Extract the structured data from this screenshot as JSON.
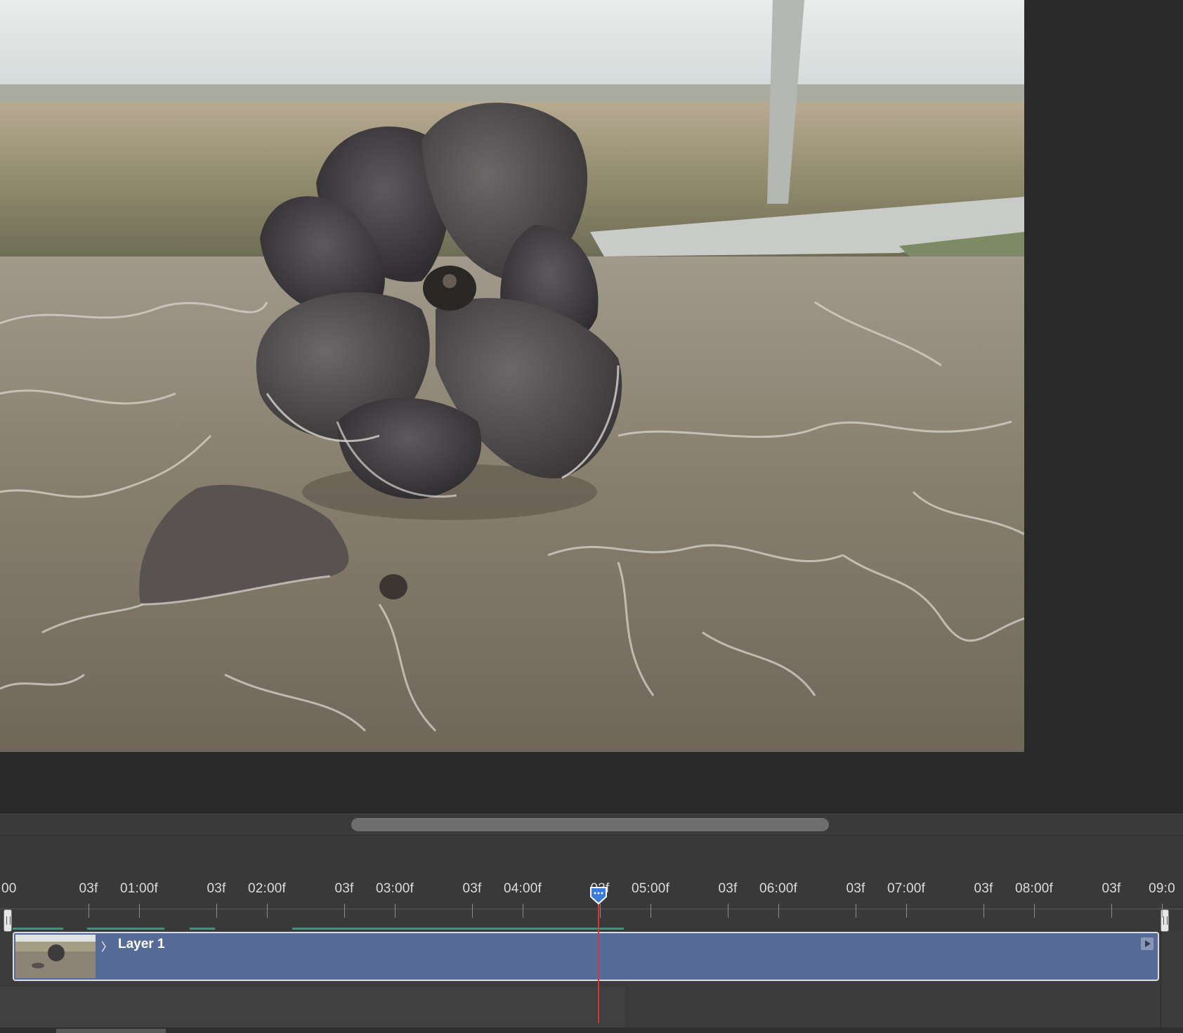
{
  "timeline": {
    "ruler_labels": [
      {
        "label": "00"
      },
      {
        "label": "03f"
      },
      {
        "label": "01:00f"
      },
      {
        "label": "03f"
      },
      {
        "label": "02:00f"
      },
      {
        "label": "03f"
      },
      {
        "label": "03:00f"
      },
      {
        "label": "03f"
      },
      {
        "label": "04:00f"
      },
      {
        "label": "03f"
      },
      {
        "label": "05:00f"
      },
      {
        "label": "03f"
      },
      {
        "label": "06:00f"
      },
      {
        "label": "03f"
      },
      {
        "label": "07:00f"
      },
      {
        "label": "03f"
      },
      {
        "label": "08:00f"
      },
      {
        "label": "03f"
      },
      {
        "label": "09:0"
      }
    ],
    "layer": {
      "name": "Layer 1",
      "disclosure": "〉"
    },
    "colors": {
      "clip": "#566b98",
      "playhead": "#d23a2e",
      "playhead_marker": "#3d7ad6",
      "cached": "#4a8f7e"
    },
    "icons": {
      "playhead": "playhead-marker-icon",
      "work_area_start": "work-area-start-handle",
      "work_area_end": "work-area-end-handle",
      "clip_end": "clip-end-arrow-icon"
    }
  }
}
